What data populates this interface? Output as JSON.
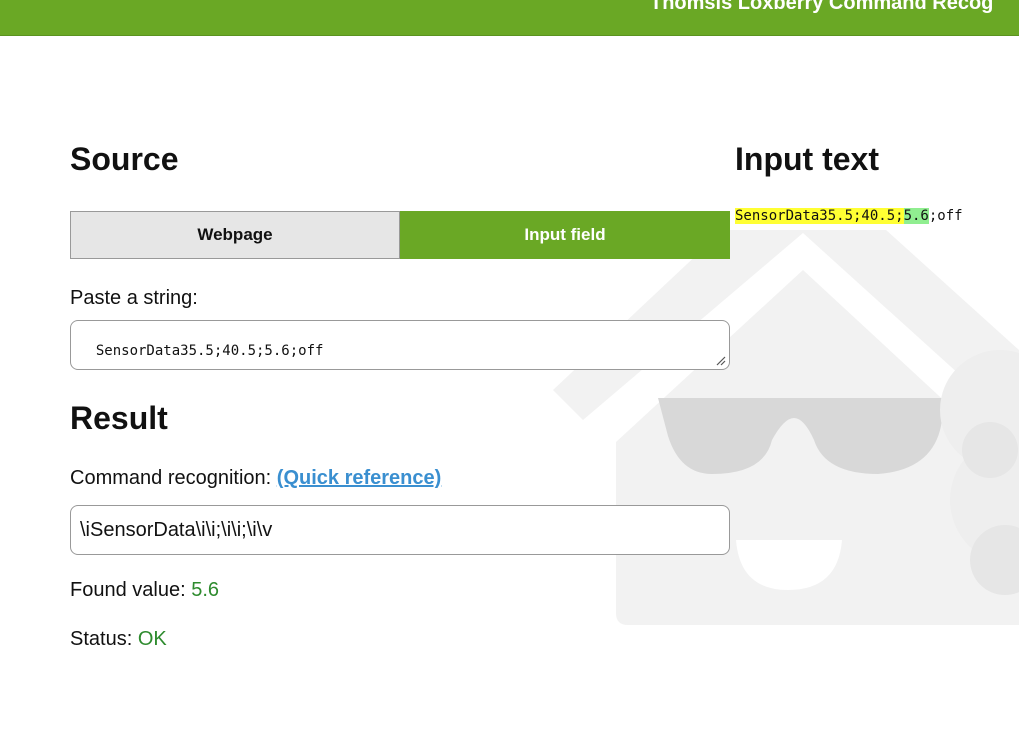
{
  "header": {
    "title": "Thomsis Loxberry Command Recog"
  },
  "source": {
    "heading": "Source",
    "options": [
      {
        "label": "Webpage",
        "selected": false
      },
      {
        "label": "Input field",
        "selected": true
      }
    ],
    "paste_label": "Paste a string:",
    "paste_value": "SensorData35.5;40.5;5.6;off"
  },
  "input_text": {
    "heading": "Input text",
    "segments": [
      {
        "text": "SensorData35.5;40.5;",
        "highlight": "yellow"
      },
      {
        "text": "5.6",
        "highlight": "green"
      },
      {
        "text": ";off",
        "highlight": "none"
      }
    ]
  },
  "result": {
    "heading": "Result",
    "command_label": "Command recognition:",
    "quick_reference_link": "(Quick reference)",
    "command_value": "\\iSensorData\\i\\i;\\i\\i;\\i\\v",
    "found_label": "Found value:",
    "found_value": "5.6",
    "status_label": "Status:",
    "status_value": "OK"
  },
  "colors": {
    "accent": "#6aa825",
    "link": "#3a8fd0",
    "success": "#2e8b2e",
    "highlight_match": "#ffff33",
    "highlight_value": "#90ee90"
  }
}
